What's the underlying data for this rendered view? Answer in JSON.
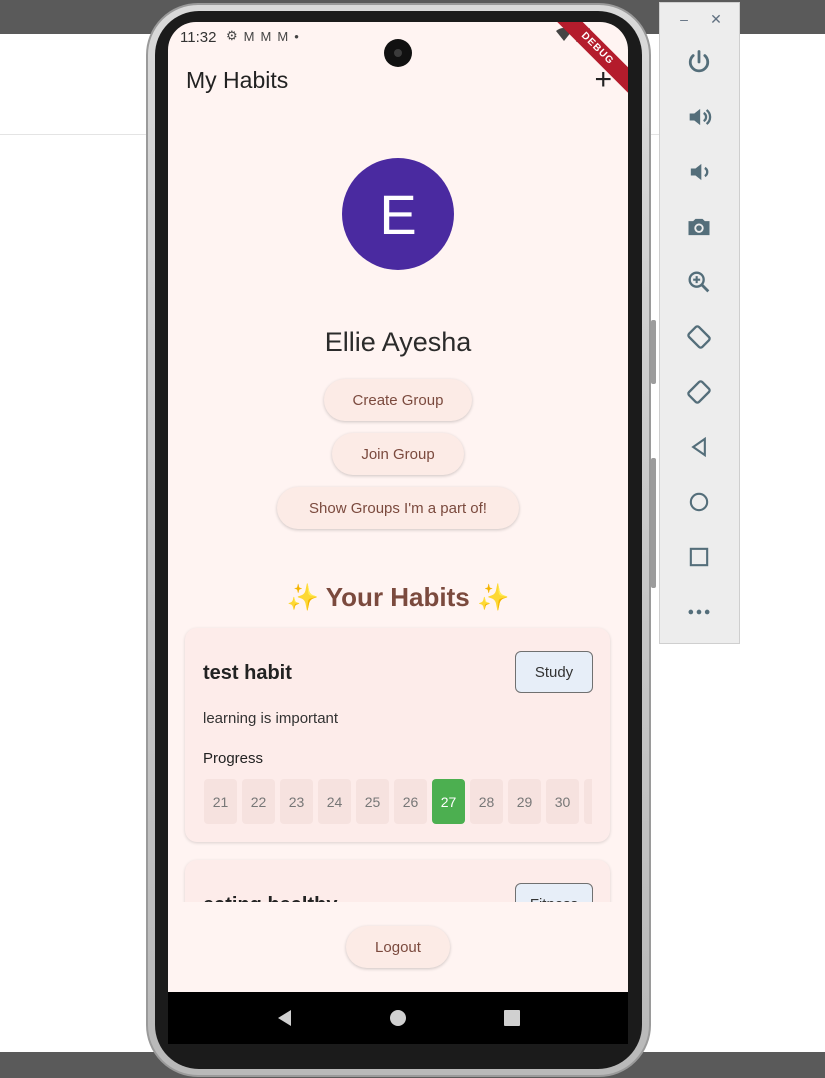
{
  "status_bar": {
    "time": "11:32",
    "debug_label": "DEBUG"
  },
  "app_bar": {
    "title": "My Habits",
    "add_icon": "plus-icon"
  },
  "profile": {
    "initial": "E",
    "name": "Ellie Ayesha",
    "avatar_color": "#4a2aa0"
  },
  "actions": {
    "create_group": "Create Group",
    "join_group": "Join Group",
    "show_groups": "Show Groups I'm a part of!"
  },
  "habits_section": {
    "heading": "✨ Your Habits ✨"
  },
  "habits": [
    {
      "title": "test habit",
      "category": "Study",
      "description": "learning is important",
      "progress_label": "Progress",
      "days": [
        {
          "label": "21",
          "done": false
        },
        {
          "label": "22",
          "done": false
        },
        {
          "label": "23",
          "done": false
        },
        {
          "label": "24",
          "done": false
        },
        {
          "label": "25",
          "done": false
        },
        {
          "label": "26",
          "done": false
        },
        {
          "label": "27",
          "done": true
        },
        {
          "label": "28",
          "done": false
        },
        {
          "label": "29",
          "done": false
        },
        {
          "label": "30",
          "done": false
        },
        {
          "label": "",
          "done": false
        }
      ]
    },
    {
      "title": "eating healthy",
      "category": "Fitness"
    }
  ],
  "logout": {
    "label": "Logout"
  },
  "colors": {
    "accent": "#7b4a3e",
    "completed_day": "#4caf50",
    "screen_bg": "#fff4f2"
  },
  "emulator_toolbar": {
    "window_controls": [
      "–",
      "✕"
    ],
    "buttons": [
      "power-icon",
      "volume-up-icon",
      "volume-down-icon",
      "camera-icon",
      "zoom-icon",
      "rotate-left-icon",
      "rotate-right-icon",
      "back-icon",
      "home-icon",
      "overview-icon",
      "more-icon"
    ]
  }
}
